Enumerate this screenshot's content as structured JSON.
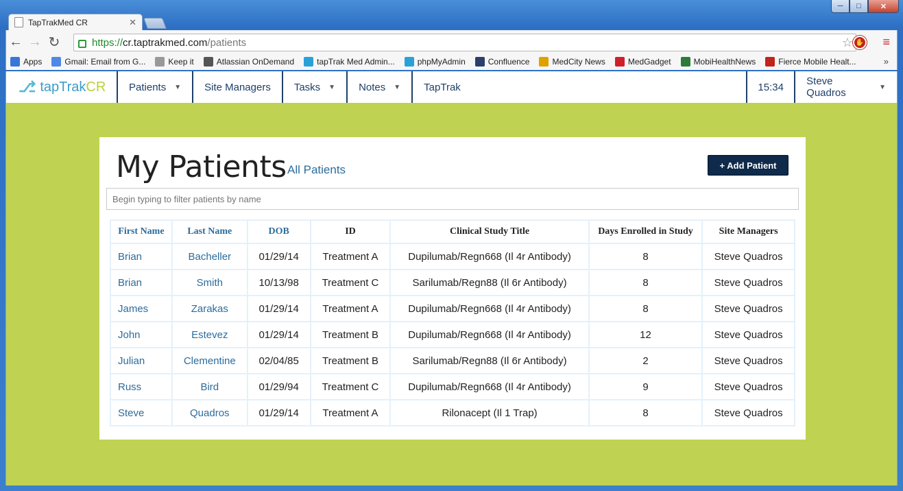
{
  "browser": {
    "tab_title": "TapTrakMed CR",
    "url": {
      "scheme": "https://",
      "host": "cr.taptrakmed.com",
      "path": "/patients"
    },
    "bookmarks": [
      {
        "label": "Apps",
        "icon": "apps-grid-icon",
        "color": "#3a76d8"
      },
      {
        "label": "Gmail: Email from G...",
        "icon": "google-icon",
        "color": "#4f88e6"
      },
      {
        "label": "Keep it",
        "icon": "page-icon",
        "color": "#999999"
      },
      {
        "label": "Atlassian OnDemand",
        "icon": "avatar-icon",
        "color": "#555555"
      },
      {
        "label": "tapTrak Med Admin...",
        "icon": "med-icon",
        "color": "#2aa0d8"
      },
      {
        "label": "phpMyAdmin",
        "icon": "med-icon",
        "color": "#2aa0d8"
      },
      {
        "label": "Confluence",
        "icon": "confluence-icon",
        "color": "#2b3f6b"
      },
      {
        "label": "MedCity News",
        "icon": "skyline-icon",
        "color": "#e0a000"
      },
      {
        "label": "MedGadget",
        "icon": "m-icon",
        "color": "#d0202a"
      },
      {
        "label": "MobiHealthNews",
        "icon": "m-square-icon",
        "color": "#2d7a3a"
      },
      {
        "label": "Fierce Mobile Healt...",
        "icon": "fm-icon",
        "color": "#c0241a"
      }
    ],
    "bookmarks_more": "»"
  },
  "nav": {
    "brand_prefix": "tapTrak",
    "brand_suffix": "CR",
    "items": [
      {
        "label": "Patients",
        "has_caret": true
      },
      {
        "label": "Site Managers",
        "has_caret": false
      },
      {
        "label": "Tasks",
        "has_caret": true
      },
      {
        "label": "Notes",
        "has_caret": true
      },
      {
        "label": "TapTrak",
        "has_caret": false
      }
    ],
    "time": "15:34",
    "user": "Steve Quadros"
  },
  "page": {
    "title": "My Patients",
    "all_link": "All Patients",
    "add_button": "+ Add Patient",
    "filter_placeholder": "Begin typing to filter patients by name"
  },
  "table": {
    "columns": [
      "First Name",
      "Last Name",
      "DOB",
      "ID",
      "Clinical Study Title",
      "Days Enrolled in Study",
      "Site Managers"
    ],
    "rows": [
      [
        "Brian",
        "Bacheller",
        "01/29/14",
        "Treatment A",
        "Dupilumab/Regn668 (Il 4r Antibody)",
        "8",
        "Steve Quadros"
      ],
      [
        "Brian",
        "Smith",
        "10/13/98",
        "Treatment C",
        "Sarilumab/Regn88 (Il 6r Antibody)",
        "8",
        "Steve Quadros"
      ],
      [
        "James",
        "Zarakas",
        "01/29/14",
        "Treatment A",
        "Dupilumab/Regn668 (Il 4r Antibody)",
        "8",
        "Steve Quadros"
      ],
      [
        "John",
        "Estevez",
        "01/29/14",
        "Treatment B",
        "Dupilumab/Regn668 (Il 4r Antibody)",
        "12",
        "Steve Quadros"
      ],
      [
        "Julian",
        "Clementine",
        "02/04/85",
        "Treatment B",
        "Sarilumab/Regn88 (Il 6r Antibody)",
        "2",
        "Steve Quadros"
      ],
      [
        "Russ",
        "Bird",
        "01/29/94",
        "Treatment C",
        "Dupilumab/Regn668 (Il 4r Antibody)",
        "9",
        "Steve Quadros"
      ],
      [
        "Steve",
        "Quadros",
        "01/29/14",
        "Treatment A",
        "Rilonacept (Il 1 Trap)",
        "8",
        "Steve Quadros"
      ]
    ]
  },
  "colors": {
    "accent_green": "#bfd252",
    "nav_blue": "#1e3f69",
    "link_blue": "#2c6c9c",
    "button_navy": "#0f2a4a"
  }
}
